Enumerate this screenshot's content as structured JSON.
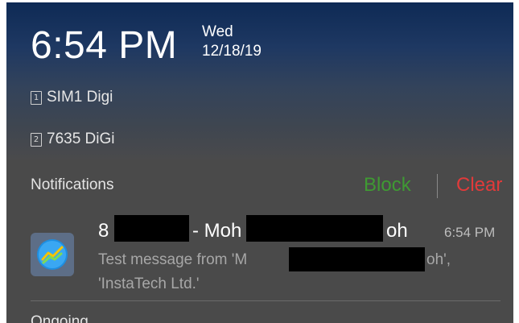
{
  "status": {
    "time": "6:54 PM",
    "day": "Wed",
    "date": "12/18/19"
  },
  "sims": [
    {
      "badge": "1",
      "name": "SIM1 Digi"
    },
    {
      "badge": "2",
      "name": "7635 DiGi"
    }
  ],
  "notifications": {
    "title": "Notifications",
    "block_label": "Block",
    "clear_label": "Clear",
    "items": [
      {
        "sender_prefix": "8",
        "sender_separator": "- Moh",
        "sender_suffix": "oh",
        "time": "6:54 PM",
        "message_prefix": "Test message from 'M",
        "message_suffix": "oh',",
        "message_line2": "'InstaTech Ltd.'",
        "app_icon": "metatrader-app-icon"
      }
    ]
  },
  "ongoing_title": "Ongoing",
  "colors": {
    "block": "#3f9a33",
    "clear": "#e23a3a",
    "panel_top": "#0e2a55",
    "panel_bottom": "#4a4a4a"
  }
}
